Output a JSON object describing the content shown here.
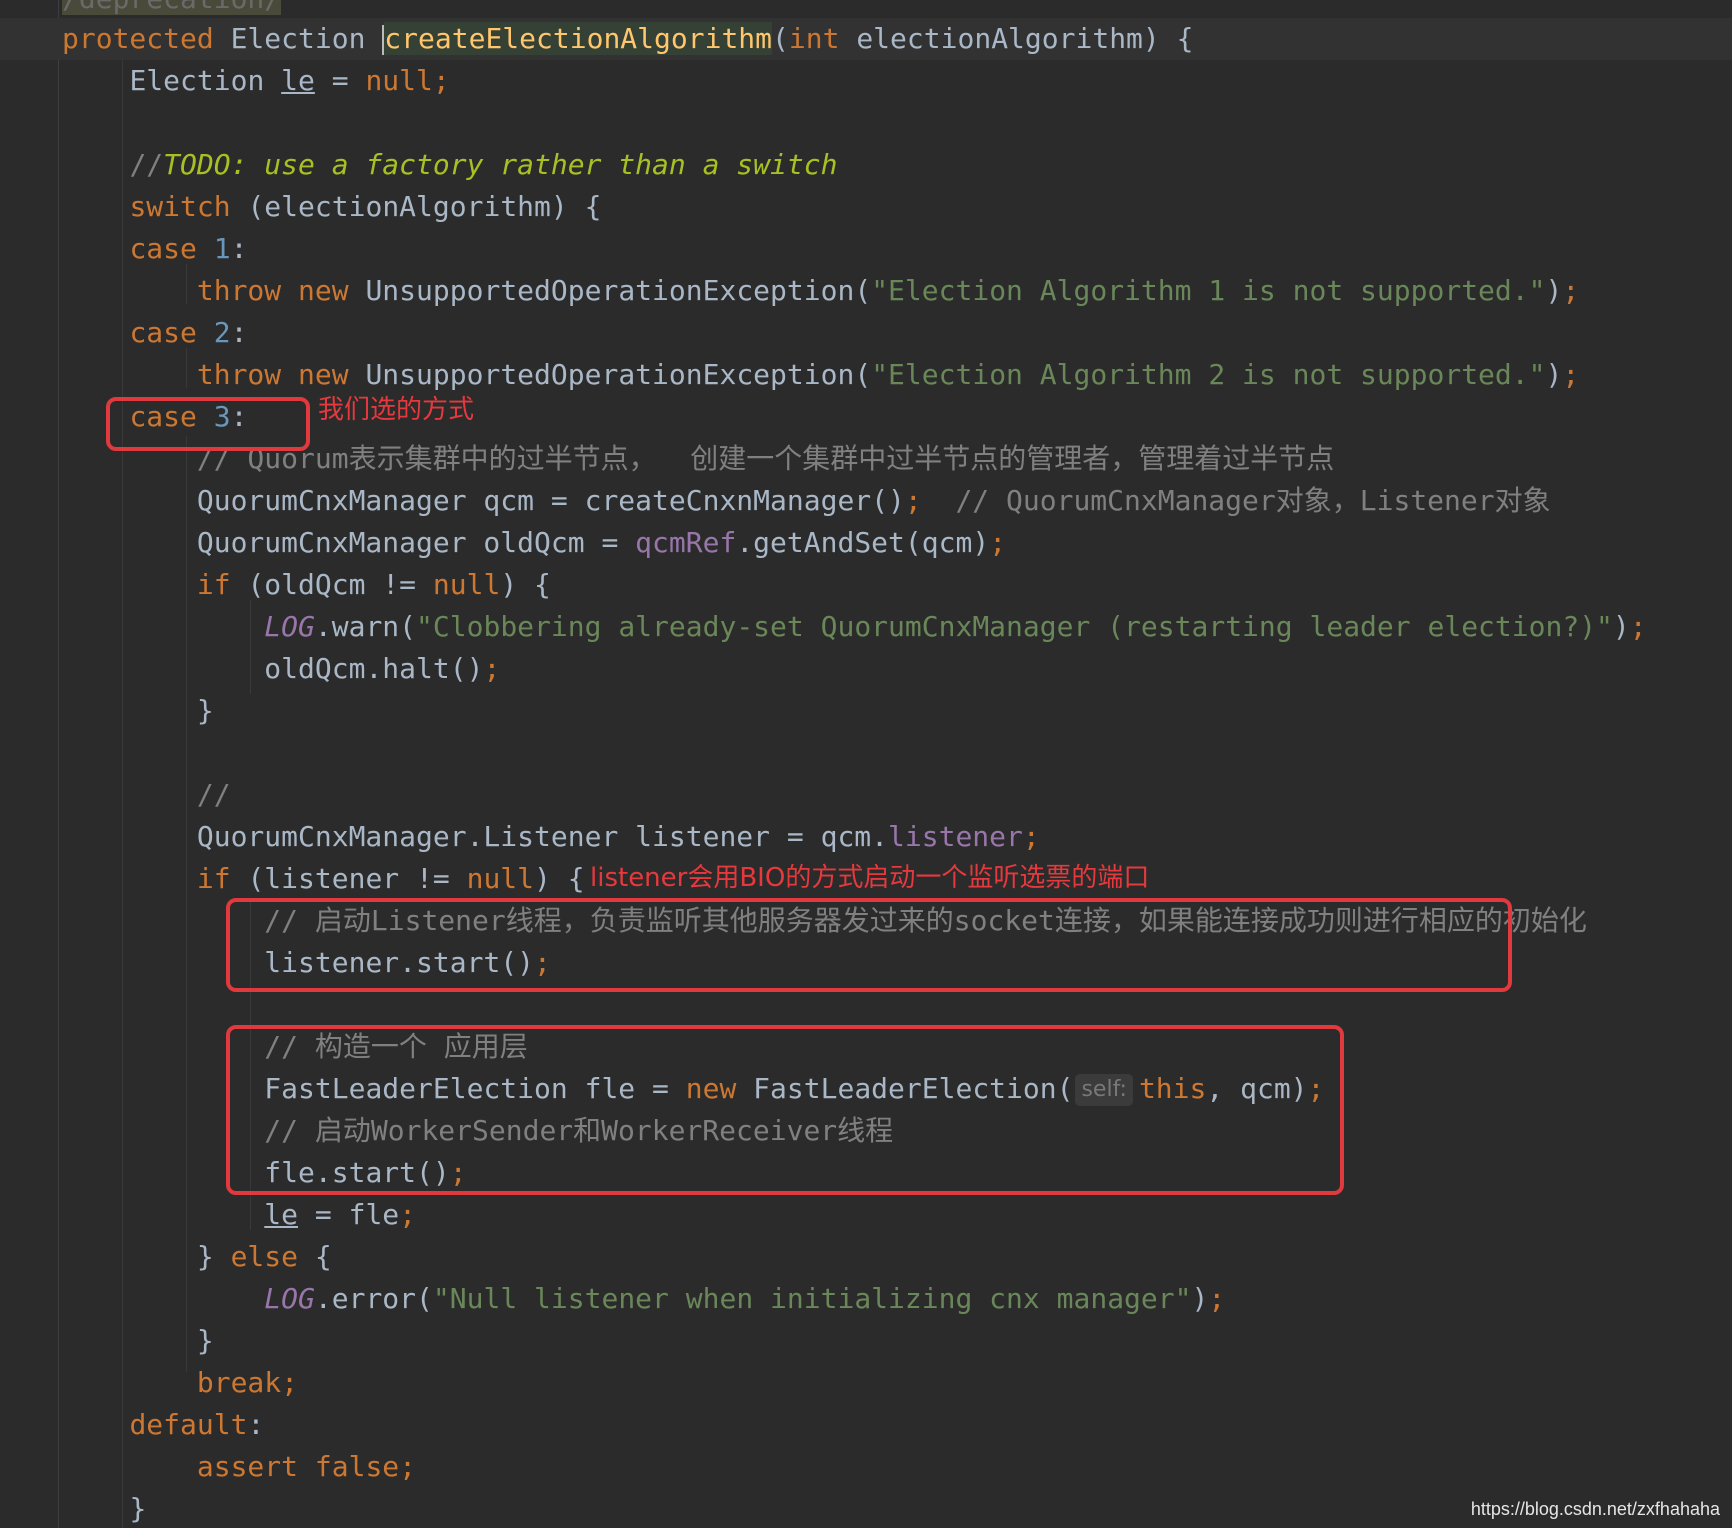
{
  "colors": {
    "background": "#2b2b2b",
    "keyword": "#cc7832",
    "number": "#6897bb",
    "string": "#6a8759",
    "comment": "#808080",
    "todo": "#a8c023",
    "field": "#9876aa",
    "annotation_red": "#e0393e"
  },
  "top_annotation": "/deprecation/",
  "code": {
    "signature": {
      "protected": "protected",
      "type": "Election",
      "method": "createElectionAlgorithm",
      "open_paren": "(",
      "param_type": "int",
      "param_rest": "electionAlgorithm) {"
    },
    "decl": {
      "type": "Election",
      "var": "le",
      "eq": "=",
      "null": "null",
      "semi": ";"
    },
    "todo": {
      "slashes": "//",
      "text": "TODO: use a factory rather than a switch"
    },
    "switch": {
      "kw": "switch",
      "rest": "(electionAlgorithm) {"
    },
    "case1": {
      "kw": "case",
      "num": "1",
      "colon": ":"
    },
    "throw1": {
      "throw": "throw",
      "new": "new",
      "cls": "UnsupportedOperationException(",
      "msg": "\"Election Algorithm 1 is not supported.\"",
      "end": ")",
      "semi": ";"
    },
    "case2": {
      "kw": "case",
      "num": "2",
      "colon": ":"
    },
    "throw2": {
      "throw": "throw",
      "new": "new",
      "cls": "UnsupportedOperationException(",
      "msg": "\"Election Algorithm 2 is not supported.\"",
      "end": ")",
      "semi": ";"
    },
    "case3": {
      "kw": "case",
      "num": "3",
      "colon": ":"
    },
    "comment_quorum": "// Quorum表示集群中的过半节点，  创建一个集群中过半节点的管理者，管理着过半节点",
    "qcm": {
      "text": "QuorumCnxManager qcm = createCnxnManager()",
      "semi": ";",
      "comment": "  // QuorumCnxManager对象，Listener对象"
    },
    "oldqcm": {
      "pre": "QuorumCnxManager oldQcm = ",
      "field": "qcmRef",
      "post": ".getAndSet(qcm)",
      "semi": ";"
    },
    "if_old": {
      "kw": "if",
      "pre": "(oldQcm != ",
      "null": "null",
      "post": ") {"
    },
    "log_warn": {
      "log": "LOG",
      "call": ".warn(",
      "msg": "\"Clobbering already-set QuorumCnxManager (restarting leader election?)\"",
      "end": ")",
      "semi": ";"
    },
    "halt": {
      "text": "oldQcm.halt()",
      "semi": ";"
    },
    "close_brace": "}",
    "empty_comment": "//",
    "listener_decl": {
      "pre": "QuorumCnxManager.Listener listener = qcm.",
      "field": "listener",
      "semi": ";"
    },
    "if_listener": {
      "kw": "if",
      "pre": "(listener != ",
      "null": "null",
      "post": ") {"
    },
    "comment_listener": "// 启动Listener线程，负责监听其他服务器发过来的socket连接，如果能连接成功则进行相应的初始化",
    "listener_start": {
      "text": "listener.start()",
      "semi": ";"
    },
    "comment_construct": "// 构造一个 应用层",
    "fle": {
      "pre": "FastLeaderElection fle = ",
      "new": "new",
      "cls": "FastLeaderElection(",
      "hint": "self:",
      "this": "this",
      "rest": ", qcm)",
      "semi": ";"
    },
    "comment_worker": "// 启动WorkerSender和WorkerReceiver线程",
    "fle_start": {
      "text": "fle.start()",
      "semi": ";"
    },
    "assign": {
      "var": "le",
      "rest": " = fle",
      "semi": ";"
    },
    "else": {
      "brace": "} ",
      "kw": "else",
      "rest": " {"
    },
    "log_error": {
      "log": "LOG",
      "call": ".error(",
      "msg": "\"Null listener when initializing cnx manager\"",
      "end": ")",
      "semi": ";"
    },
    "break": {
      "kw": "break",
      "semi": ";"
    },
    "default": {
      "kw": "default",
      "colon": ":"
    },
    "assert": {
      "kw": "assert",
      "false": "false",
      "semi": ";"
    }
  },
  "notes": {
    "case3": "我们选的方式",
    "listener": "listener会用BIO的方式启动一个监听选票的端口"
  },
  "watermark": "https://blog.csdn.net/zxfhahaha"
}
